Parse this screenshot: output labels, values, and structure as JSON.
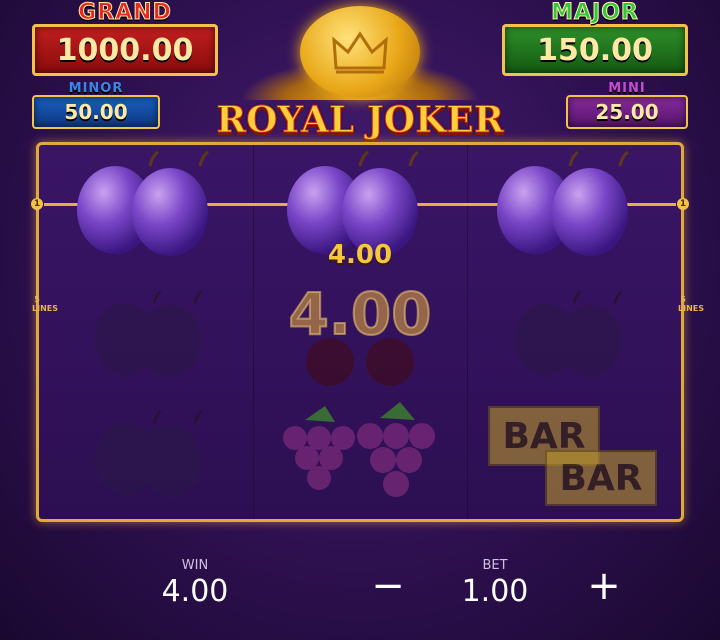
{
  "jackpots": {
    "grand": {
      "label": "GRAND",
      "value": "1000.00"
    },
    "major": {
      "label": "MAJOR",
      "value": "150.00"
    },
    "minor": {
      "label": "MINOR",
      "value": "50.00"
    },
    "mini": {
      "label": "MINI",
      "value": "25.00"
    }
  },
  "logo": {
    "text": "ROYAL JOKER"
  },
  "reels": {
    "payline_number": "1",
    "side_label": "5 LINES",
    "line_win": "4.00",
    "big_win": "4.00",
    "bar_label": "BAR"
  },
  "symbols": {
    "row1": [
      "plum",
      "plum",
      "plum"
    ],
    "row2": [
      "plum",
      "cherry",
      "plum"
    ],
    "row3": [
      "plum",
      "grapes",
      "bar"
    ]
  },
  "footer": {
    "win_label": "WIN",
    "win_value": "4.00",
    "bet_label": "BET",
    "bet_value": "1.00",
    "minus": "−",
    "plus": "+"
  },
  "colors": {
    "grand": "#c21f1f",
    "major": "#2f8f2a",
    "minor": "#1b5fc0",
    "mini": "#8a2aa0",
    "gold": "#f3c24a",
    "background": "#2e1050"
  }
}
